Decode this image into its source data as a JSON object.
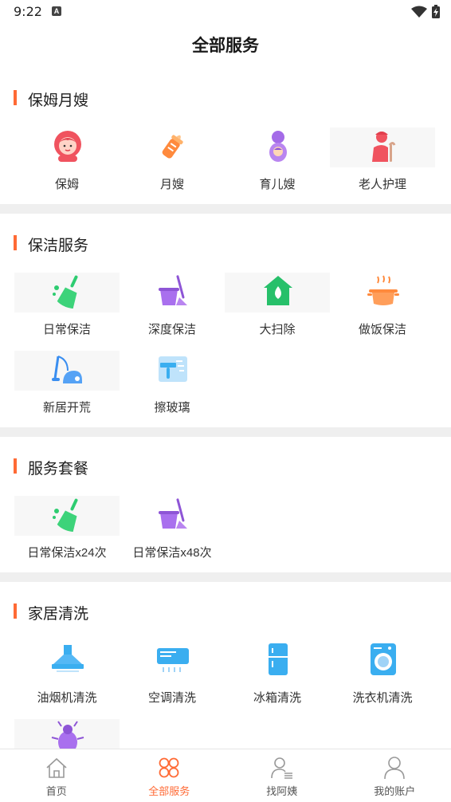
{
  "status": {
    "time": "9:22",
    "notice_icon": "a-letter-icon",
    "wifi_icon": "wifi-icon",
    "battery_icon": "battery-charging-icon"
  },
  "header": {
    "title": "全部服务"
  },
  "sections": [
    {
      "title": "保姆月嫂",
      "items": [
        {
          "label": "保姆",
          "icon": "nanny-icon"
        },
        {
          "label": "月嫂",
          "icon": "baby-bottle-icon"
        },
        {
          "label": "育儿嫂",
          "icon": "childcare-icon"
        },
        {
          "label": "老人护理",
          "icon": "elderly-care-icon"
        }
      ]
    },
    {
      "title": "保洁服务",
      "items": [
        {
          "label": "日常保洁",
          "icon": "broom-icon"
        },
        {
          "label": "深度保洁",
          "icon": "bucket-mop-icon"
        },
        {
          "label": "大扫除",
          "icon": "house-drop-icon"
        },
        {
          "label": "做饭保洁",
          "icon": "cooking-pot-icon"
        },
        {
          "label": "新居开荒",
          "icon": "vacuum-icon"
        },
        {
          "label": "擦玻璃",
          "icon": "window-wiper-icon"
        }
      ]
    },
    {
      "title": "服务套餐",
      "items": [
        {
          "label": "日常保洁x24次",
          "icon": "broom-icon"
        },
        {
          "label": "日常保洁x48次",
          "icon": "bucket-mop-icon"
        }
      ]
    },
    {
      "title": "家居清洗",
      "items": [
        {
          "label": "油烟机清洗",
          "icon": "range-hood-icon"
        },
        {
          "label": "空调清洗",
          "icon": "air-conditioner-icon"
        },
        {
          "label": "冰箱清洗",
          "icon": "fridge-icon"
        },
        {
          "label": "洗衣机清洗",
          "icon": "washing-machine-icon"
        },
        {
          "label": "",
          "icon": "bug-icon"
        }
      ]
    }
  ],
  "nav": [
    {
      "label": "首页",
      "icon": "home-icon",
      "active": false
    },
    {
      "label": "全部服务",
      "icon": "services-grid-icon",
      "active": true
    },
    {
      "label": "找阿姨",
      "icon": "find-person-icon",
      "active": false
    },
    {
      "label": "我的账户",
      "icon": "account-icon",
      "active": false
    }
  ],
  "colors": {
    "accent": "#ff6a35",
    "section_gap": "#efefef"
  }
}
